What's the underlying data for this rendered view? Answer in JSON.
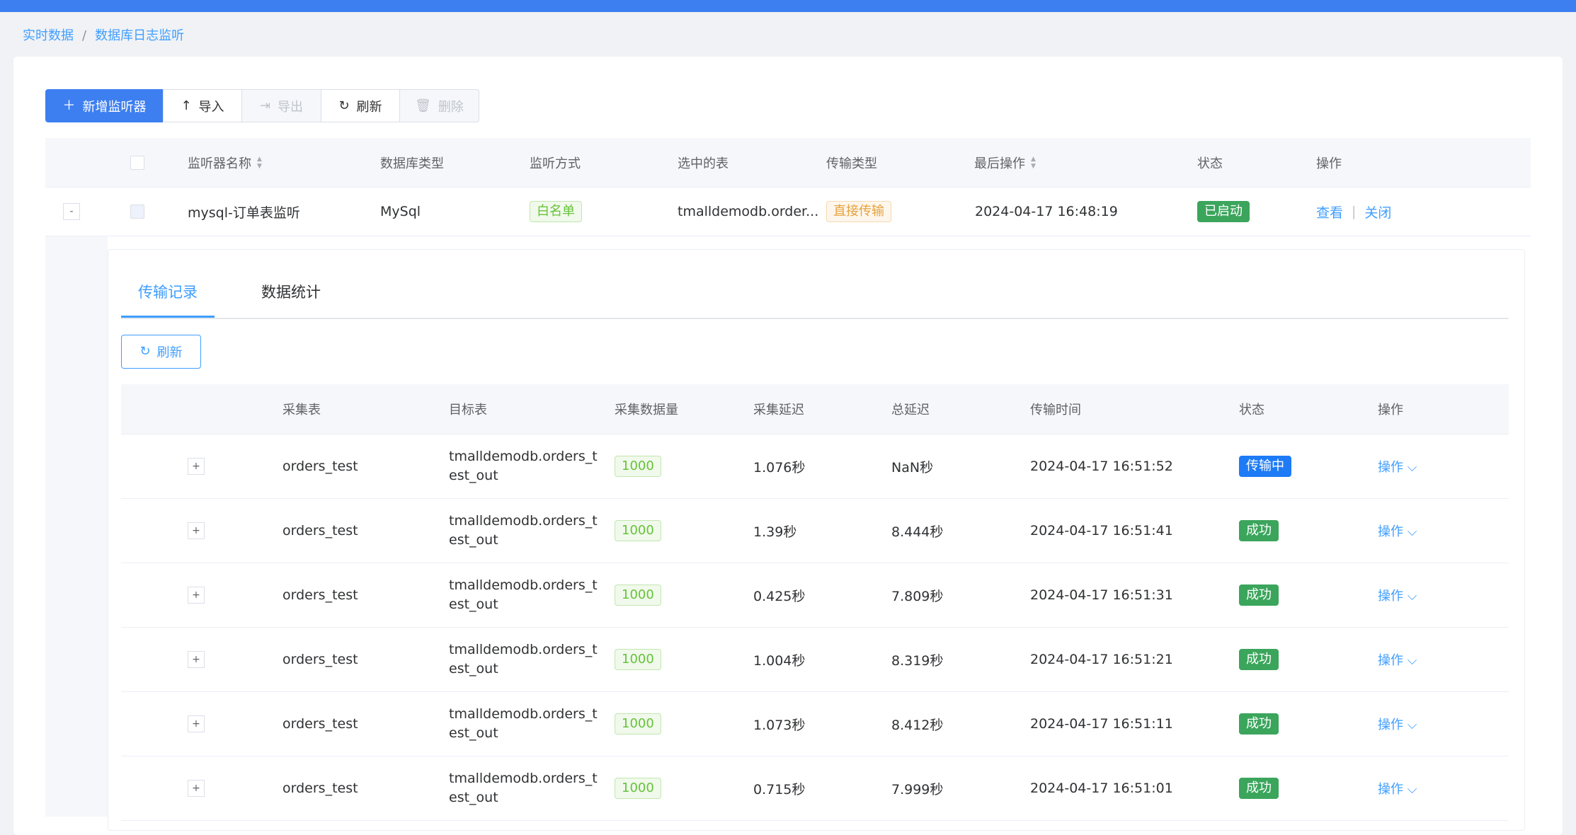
{
  "breadcrumb": {
    "items": [
      "实时数据",
      "数据库日志监听"
    ]
  },
  "toolbar": {
    "add": "新增监听器",
    "import": "导入",
    "export": "导出",
    "refresh": "刷新",
    "delete": "删除"
  },
  "outer_table": {
    "headers": [
      "监听器名称",
      "数据库类型",
      "监听方式",
      "选中的表",
      "传输类型",
      "最后操作",
      "状态",
      "操作"
    ],
    "row": {
      "expander": "-",
      "name": "mysql-订单表监听",
      "db_type": "MySql",
      "listen_mode": "白名单",
      "tables": "tmalldemodb.order...",
      "transfer_type": "直接传输",
      "last_op": "2024-04-17 16:48:19",
      "status": "已启动",
      "view": "查看",
      "close": "关闭"
    }
  },
  "tabs": [
    "传输记录",
    "数据统计"
  ],
  "inner_refresh": "刷新",
  "inner_table": {
    "headers": [
      "采集表",
      "目标表",
      "采集数据量",
      "采集延迟",
      "总延迟",
      "传输时间",
      "状态",
      "操作"
    ],
    "rows": [
      {
        "expander": "+",
        "source": "orders_test",
        "target": "tmalldemodb.orders_test_out",
        "count": "1000",
        "collect_delay": "1.076秒",
        "total_delay": "NaN秒",
        "time": "2024-04-17 16:51:52",
        "status": "传输中",
        "status_kind": "running",
        "action": "操作"
      },
      {
        "expander": "+",
        "source": "orders_test",
        "target": "tmalldemodb.orders_test_out",
        "count": "1000",
        "collect_delay": "1.39秒",
        "total_delay": "8.444秒",
        "time": "2024-04-17 16:51:41",
        "status": "成功",
        "status_kind": "success",
        "action": "操作"
      },
      {
        "expander": "+",
        "source": "orders_test",
        "target": "tmalldemodb.orders_test_out",
        "count": "1000",
        "collect_delay": "0.425秒",
        "total_delay": "7.809秒",
        "time": "2024-04-17 16:51:31",
        "status": "成功",
        "status_kind": "success",
        "action": "操作"
      },
      {
        "expander": "+",
        "source": "orders_test",
        "target": "tmalldemodb.orders_test_out",
        "count": "1000",
        "collect_delay": "1.004秒",
        "total_delay": "8.319秒",
        "time": "2024-04-17 16:51:21",
        "status": "成功",
        "status_kind": "success",
        "action": "操作"
      },
      {
        "expander": "+",
        "source": "orders_test",
        "target": "tmalldemodb.orders_test_out",
        "count": "1000",
        "collect_delay": "1.073秒",
        "total_delay": "8.412秒",
        "time": "2024-04-17 16:51:11",
        "status": "成功",
        "status_kind": "success",
        "action": "操作"
      },
      {
        "expander": "+",
        "source": "orders_test",
        "target": "tmalldemodb.orders_test_out",
        "count": "1000",
        "collect_delay": "0.715秒",
        "total_delay": "7.999秒",
        "time": "2024-04-17 16:51:01",
        "status": "成功",
        "status_kind": "success",
        "action": "操作"
      }
    ]
  },
  "colors": {
    "primary": "#409eff",
    "header_bar": "#3d7ff0",
    "success": "#3ba55c",
    "running": "#1e7bf6"
  }
}
